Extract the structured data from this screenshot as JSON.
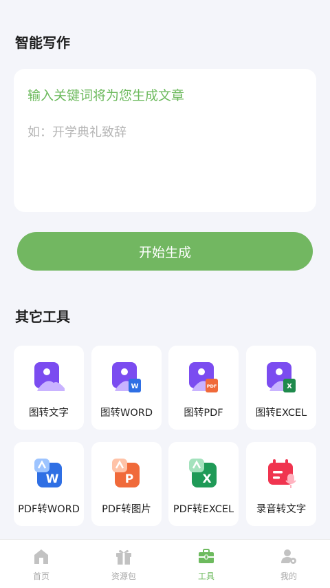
{
  "section_write": {
    "title": "智能写作"
  },
  "write_box": {
    "hint": "输入关键词将为您生成文章",
    "placeholder": "如：开学典礼致辞"
  },
  "generate_button": "开始生成",
  "section_tools": {
    "title": "其它工具"
  },
  "tools": [
    {
      "label": "图转文字",
      "icon": "image-icon"
    },
    {
      "label": "图转WORD",
      "icon": "image-to-word-icon"
    },
    {
      "label": "图转PDF",
      "icon": "image-to-pdf-icon"
    },
    {
      "label": "图转EXCEL",
      "icon": "image-to-excel-icon"
    },
    {
      "label": "PDF转WORD",
      "icon": "pdf-to-word-icon"
    },
    {
      "label": "PDF转图片",
      "icon": "pdf-to-image-icon"
    },
    {
      "label": "PDF转EXCEL",
      "icon": "pdf-to-excel-icon"
    },
    {
      "label": "录音转文字",
      "icon": "recording-to-text-icon"
    }
  ],
  "tabbar": [
    {
      "label": "首页",
      "icon": "home-icon",
      "active": false
    },
    {
      "label": "资源包",
      "icon": "gift-icon",
      "active": false
    },
    {
      "label": "工具",
      "icon": "toolbox-icon",
      "active": true
    },
    {
      "label": "我的",
      "icon": "user-settings-icon",
      "active": false
    }
  ],
  "colors": {
    "accent": "#72b761",
    "accent_text": "#6dba5e",
    "purple": "#7b4cf0",
    "inactive": "#a9a9a9"
  }
}
